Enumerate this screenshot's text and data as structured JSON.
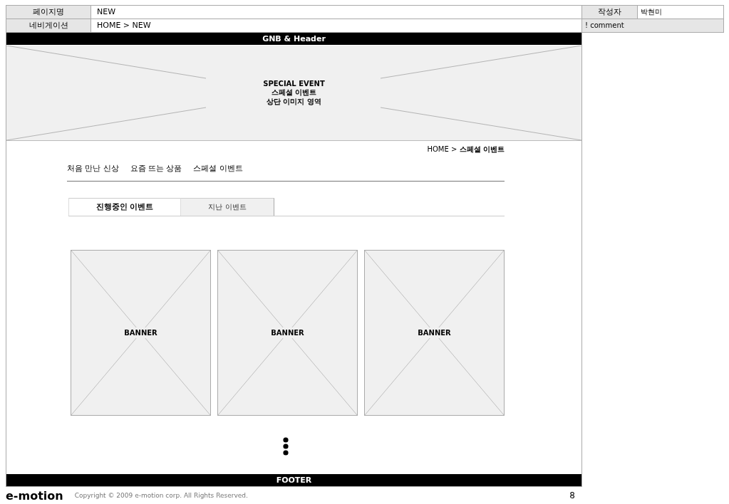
{
  "header_table": {
    "page_name_label": "페이지명",
    "page_name": "NEW",
    "author_label": "작성자",
    "author": "박현미",
    "navigation_label": "네비게이션",
    "navigation": "HOME > NEW",
    "comment": "! comment"
  },
  "gnb": "GNB & Header",
  "hero": {
    "lines": [
      "SPECIAL EVENT",
      "스페셜 이벤트",
      "상단 이미지 영역"
    ]
  },
  "breadcrumb": "HOME > **스페셜 이벤트**",
  "menu": [
    "처음 만난 신상",
    "요즘 뜨는 상품",
    "스페셜 이벤트"
  ],
  "tabs": [
    {
      "label": "진행중인 이벤트",
      "selected": true
    },
    {
      "label": "지난 이벤트",
      "selected": false
    }
  ],
  "banners": [
    "BANNER",
    "BANNER",
    "BANNER"
  ],
  "footer": "FOOTER",
  "slide_footer": {
    "logo": "e-motion",
    "copyright": "Copyright © 2009 e-motion corp. All Rights Reserved.",
    "page_number": "8"
  }
}
